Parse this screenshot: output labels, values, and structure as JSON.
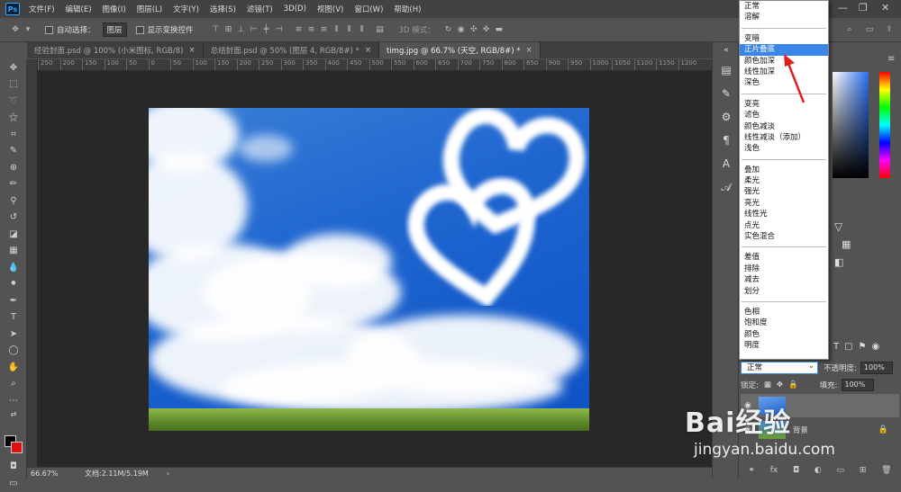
{
  "app": {
    "logo": "Ps"
  },
  "menubar": {
    "items": [
      "文件(F)",
      "编辑(E)",
      "图像(I)",
      "图层(L)",
      "文字(Y)",
      "选择(S)",
      "滤镜(T)",
      "3D(D)",
      "视图(V)",
      "窗口(W)",
      "帮助(H)"
    ]
  },
  "options": {
    "auto_select_label": "自动选择：",
    "auto_select_value": "图层",
    "show_transform_label": "显示变换控件",
    "mode_3d_label": "3D 模式："
  },
  "tabs": [
    {
      "label": "经验封面.psd @ 100% (小米图标, RGB/8)",
      "close": "×"
    },
    {
      "label": "总结封面.psd @ 50% (图层 4, RGB/8#) *",
      "close": "×"
    },
    {
      "label": "timg.jpg @ 66.7% (天空, RGB/8#) *",
      "close": "×"
    }
  ],
  "ruler": {
    "ticks": [
      "250",
      "200",
      "150",
      "100",
      "50",
      "0",
      "50",
      "100",
      "150",
      "200",
      "250",
      "300",
      "350",
      "400",
      "450",
      "500",
      "550",
      "600",
      "650",
      "700",
      "750",
      "800",
      "850",
      "900",
      "950",
      "1000",
      "1050",
      "1100",
      "1150",
      "1200"
    ]
  },
  "status": {
    "zoom": "66.67%",
    "doc": "文档:2.11M/5.19M"
  },
  "blend_menu": {
    "groups": [
      [
        "正常",
        "溶解"
      ],
      [
        "变暗",
        "正片叠底",
        "颜色加深",
        "线性加深",
        "深色"
      ],
      [
        "变亮",
        "滤色",
        "颜色减淡",
        "线性减淡（添加）",
        "浅色"
      ],
      [
        "叠加",
        "柔光",
        "强光",
        "亮光",
        "线性光",
        "点光",
        "实色混合"
      ],
      [
        "差值",
        "排除",
        "减去",
        "划分"
      ],
      [
        "色相",
        "饱和度",
        "颜色",
        "明度"
      ]
    ],
    "selected": "正片叠底"
  },
  "layers": {
    "blend_value": "正常",
    "opacity_label": "不透明度:",
    "opacity_value": "100%",
    "lock_label": "锁定:",
    "fill_label": "填充:",
    "fill_value": "100%",
    "background_label": "背景"
  },
  "watermark": {
    "brand": "Bai经验",
    "url": "jingyan.baidu.com"
  },
  "colors": {
    "accent": "#3a86e8",
    "arrow": "#e02020"
  }
}
